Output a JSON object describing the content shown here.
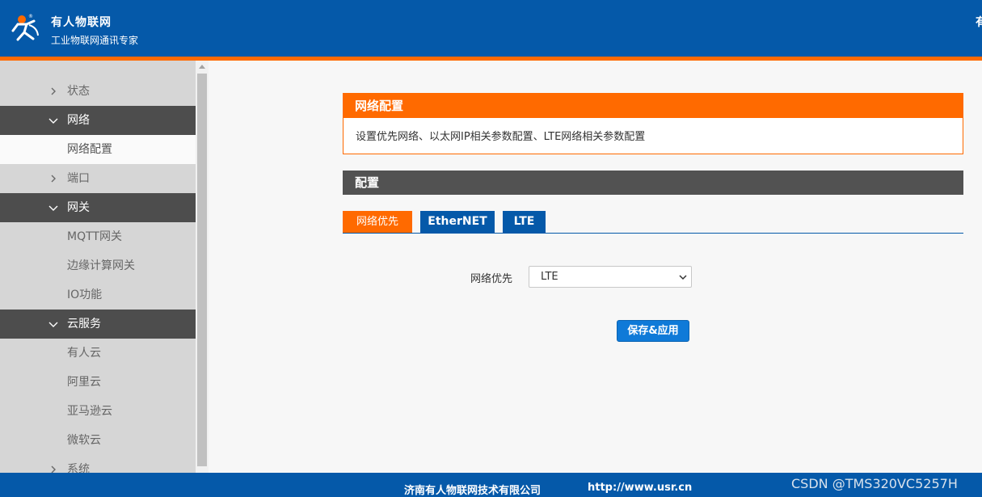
{
  "header": {
    "brand_name": "有人物联网",
    "brand_tagline": "工业物联网通讯专家",
    "right_text_cut": "有"
  },
  "sidebar": {
    "items": [
      {
        "label": "状态",
        "type": "group",
        "expanded": false
      },
      {
        "label": "网络",
        "type": "group",
        "expanded": true
      },
      {
        "label": "网络配置",
        "type": "child",
        "active": true
      },
      {
        "label": "端口",
        "type": "group",
        "expanded": false
      },
      {
        "label": "网关",
        "type": "group",
        "expanded": true
      },
      {
        "label": "MQTT网关",
        "type": "child"
      },
      {
        "label": "边缘计算网关",
        "type": "child"
      },
      {
        "label": "IO功能",
        "type": "child"
      },
      {
        "label": "云服务",
        "type": "group",
        "expanded": true
      },
      {
        "label": "有人云",
        "type": "child"
      },
      {
        "label": "阿里云",
        "type": "child"
      },
      {
        "label": "亚马逊云",
        "type": "child"
      },
      {
        "label": "微软云",
        "type": "child"
      },
      {
        "label": "系统",
        "type": "group",
        "expanded": false
      }
    ]
  },
  "intro_card": {
    "title": "网络配置",
    "description": "设置优先网络、以太网IP相关参数配置、LTE网络相关参数配置"
  },
  "config": {
    "section_title": "配置",
    "tabs": [
      {
        "label": "网络优先",
        "active": true
      },
      {
        "label": "EtherNET",
        "active": false
      },
      {
        "label": "LTE",
        "active": false
      }
    ],
    "priority_label": "网络优先",
    "priority_value": "LTE",
    "save_label": "保存&应用"
  },
  "footer": {
    "company": "济南有人物联网技术有限公司",
    "url": "http://www.usr.cn"
  },
  "watermark": "CSDN @TMS320VC5257H",
  "colors": {
    "brand_blue": "#0559a9",
    "accent_orange": "#ff6a00",
    "sidebar_bg": "#d6d6d6",
    "sidebar_open_bg": "#4d4d4d",
    "section_bar": "#525252",
    "button_blue": "#0f7ad8"
  },
  "icons": {
    "logo": "person-logo-icon",
    "collapsed": "chevron-right-icon",
    "expanded": "chevron-down-icon",
    "select_caret": "chevron-down-icon"
  }
}
